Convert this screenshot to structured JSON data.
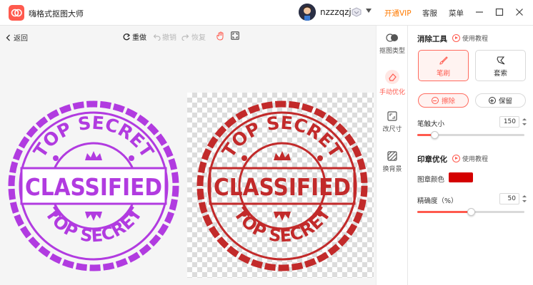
{
  "app": {
    "title": "嗨格式抠图大师"
  },
  "user": {
    "name": "nzzzqzj"
  },
  "nav": {
    "vip": "开通VIP",
    "service": "客服",
    "menu": "菜单"
  },
  "colors": {
    "accent": "#ff5a4e",
    "vip": "#ff7a00",
    "stamp_purple": "#b13be0",
    "stamp_red": "#c22a2a",
    "seal_color": "#d40000"
  },
  "toolbar": {
    "back": "返回",
    "redo": "重做",
    "undo": "撤销",
    "restore": "恢复"
  },
  "stamp": {
    "top_text": "TOP SECRET",
    "middle_text": "CLASSIFIED",
    "bottom_text": "TOP SECRET"
  },
  "side_tools": [
    {
      "label": "抠图类型",
      "icon": "toggle-icon"
    },
    {
      "label": "手动优化",
      "icon": "eraser-icon"
    },
    {
      "label": "改尺寸",
      "icon": "resize-icon"
    },
    {
      "label": "换背景",
      "icon": "background-icon"
    }
  ],
  "panel": {
    "erase_title": "消除工具",
    "help_label": "使用教程",
    "brush_label": "笔刷",
    "lasso_label": "套索",
    "erase_btn": "擦除",
    "keep_btn": "保留",
    "brush_size_label": "笔触大小",
    "brush_size_value": "150",
    "brush_size_percent": 0.16,
    "seal_title": "印章优化",
    "seal_help_label": "使用教程",
    "seal_color_label": "图章颜色",
    "precision_label": "精确度（%）",
    "precision_value": "50",
    "precision_percent": 0.5
  }
}
